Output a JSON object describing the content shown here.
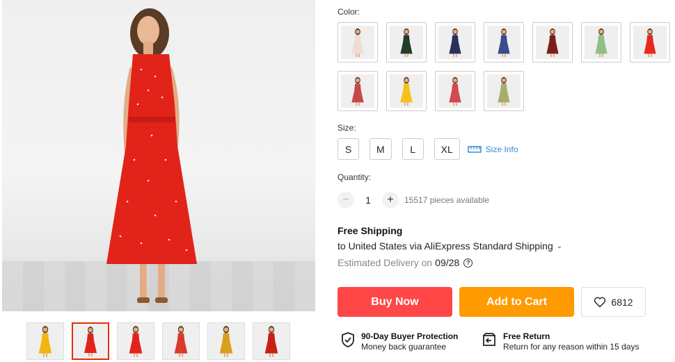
{
  "gallery": {
    "thumbnails": [
      {
        "dress_color": "#f2b614"
      },
      {
        "dress_color": "#e2231a",
        "active": true
      },
      {
        "dress_color": "#e2231a"
      },
      {
        "dress_color": "#d93a2b"
      },
      {
        "dress_color": "#d9a01c"
      },
      {
        "dress_color": "#c91f15"
      }
    ]
  },
  "options": {
    "color_label": "Color:",
    "colors": [
      "#f1dcd4",
      "#233d2a",
      "#2b2f5e",
      "#3a4c8c",
      "#7a1f1c",
      "#8fbf82",
      "#e62a1e",
      "#c9474a",
      "#f4c21a",
      "#d24a52",
      "#a8ad6a"
    ],
    "size_label": "Size:",
    "sizes": [
      "S",
      "M",
      "L",
      "XL"
    ],
    "size_info": "Size Info",
    "quantity_label": "Quantity:",
    "quantity": "1",
    "available": "15517 pieces available"
  },
  "shipping": {
    "title": "Free Shipping",
    "line": "to United States via AliExpress Standard Shipping",
    "delivery_label": "Estimated Delivery on",
    "delivery_date": "09/28"
  },
  "actions": {
    "buy_now": "Buy Now",
    "add_to_cart": "Add to Cart",
    "wishlist_count": "6812"
  },
  "guarantees": {
    "protection_title": "90-Day Buyer Protection",
    "protection_sub": "Money back guarantee",
    "return_title": "Free Return",
    "return_sub": "Return for any reason within 15 days"
  }
}
